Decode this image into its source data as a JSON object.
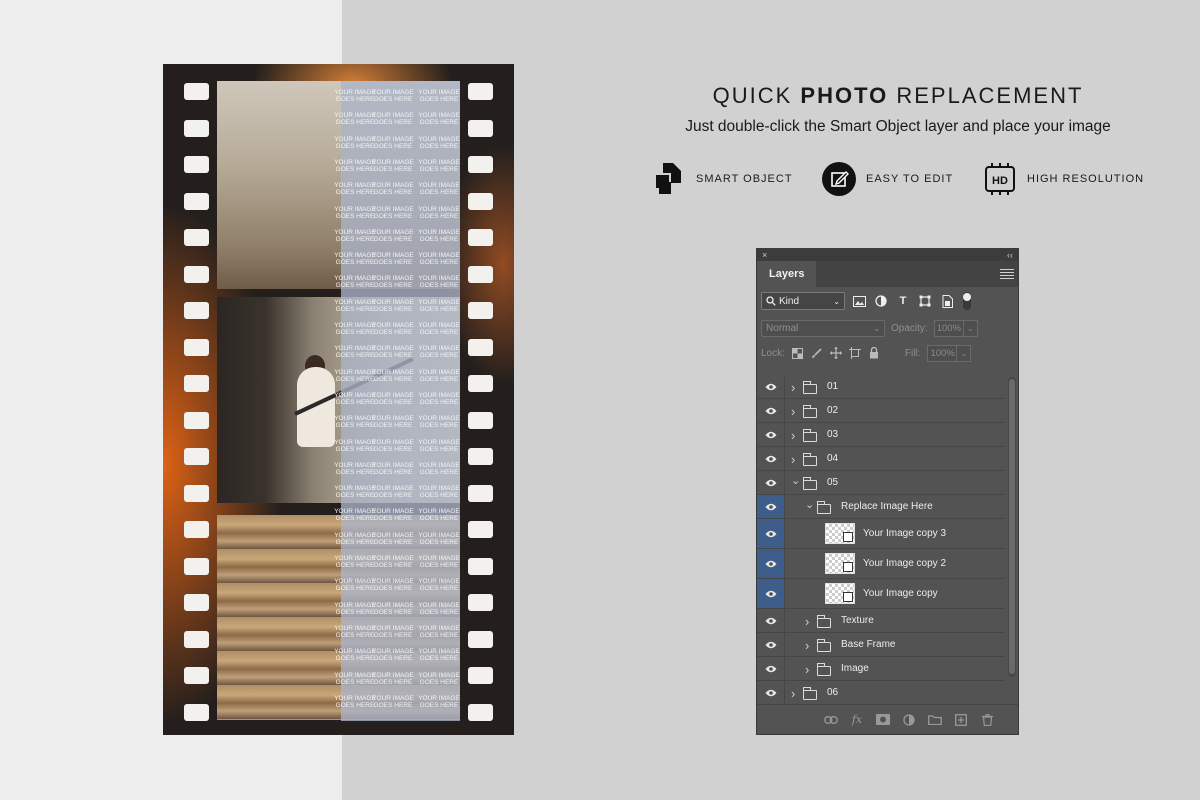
{
  "heading": {
    "title_light_1": "QUICK",
    "title_bold": "PHOTO",
    "title_light_2": "REPLACEMENT",
    "subtitle": "Just double-click the Smart Object layer and place your image"
  },
  "features": [
    {
      "label": "SMART OBJECT",
      "icon": "smart-object-icon"
    },
    {
      "label": "EASY TO EDIT",
      "icon": "edit-icon"
    },
    {
      "label": "HIGH RESOLUTION",
      "icon": "hd-icon"
    }
  ],
  "hd_badge": "HD",
  "placeholder_text": "YOUR IMAGE\nGOES HERE",
  "panel": {
    "close_glyph": "×",
    "collapse_glyph": "‹‹",
    "tab_label": "Layers",
    "filter_kind": "Kind",
    "blend_mode": "Normal",
    "opacity_label": "Opacity:",
    "opacity_value": "100%",
    "lock_label": "Lock:",
    "fill_label": "Fill:",
    "fill_value": "100%",
    "type_tool_glyph": "T",
    "fx_glyph": "fx",
    "layers": [
      {
        "name": "01",
        "type": "group",
        "expanded": false,
        "indent": 0,
        "selected": false
      },
      {
        "name": "02",
        "type": "group",
        "expanded": false,
        "indent": 0,
        "selected": false
      },
      {
        "name": "03",
        "type": "group",
        "expanded": false,
        "indent": 0,
        "selected": false
      },
      {
        "name": "04",
        "type": "group",
        "expanded": false,
        "indent": 0,
        "selected": false
      },
      {
        "name": "05",
        "type": "group",
        "expanded": true,
        "indent": 0,
        "selected": false
      },
      {
        "name": "Replace Image Here",
        "type": "group",
        "expanded": true,
        "indent": 1,
        "selected": true
      },
      {
        "name": "Your Image copy 3",
        "type": "smart-object",
        "indent": 2,
        "selected": true
      },
      {
        "name": "Your Image copy 2",
        "type": "smart-object",
        "indent": 2,
        "selected": true
      },
      {
        "name": "Your Image copy",
        "type": "smart-object",
        "indent": 2,
        "selected": true
      },
      {
        "name": "Texture",
        "type": "group",
        "expanded": false,
        "indent": 1,
        "selected": false
      },
      {
        "name": "Base Frame",
        "type": "group",
        "expanded": false,
        "indent": 1,
        "selected": false
      },
      {
        "name": "Image",
        "type": "group",
        "expanded": false,
        "indent": 1,
        "selected": false
      },
      {
        "name": "06",
        "type": "group",
        "expanded": false,
        "indent": 0,
        "selected": false
      }
    ]
  }
}
